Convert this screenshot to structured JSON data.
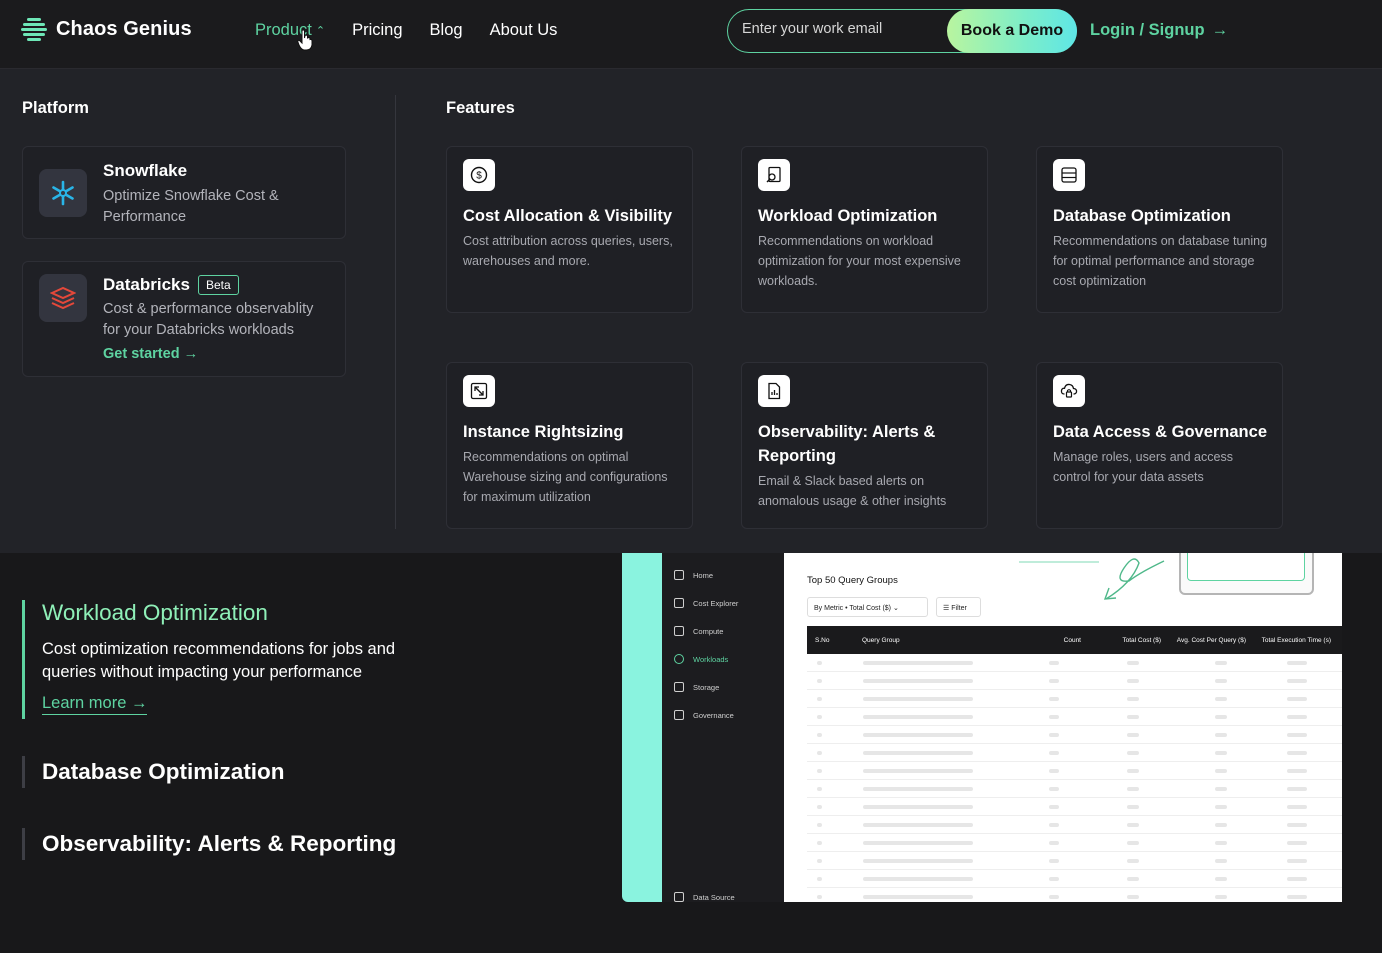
{
  "brand": {
    "name": "Chaos Genius"
  },
  "nav": {
    "items": [
      {
        "label": "Product",
        "active": true
      },
      {
        "label": "Pricing"
      },
      {
        "label": "Blog"
      },
      {
        "label": "About Us"
      }
    ],
    "email_placeholder": "Enter your work email",
    "demo_label": "Book a Demo",
    "login_label": "Login / Signup"
  },
  "platform": {
    "title": "Platform",
    "cards": [
      {
        "title": "Snowflake",
        "desc": "Optimize Snowflake Cost & Performance"
      },
      {
        "title": "Databricks",
        "badge": "Beta",
        "desc": "Cost & performance observablity for your Databricks workloads",
        "cta": "Get started"
      }
    ]
  },
  "features": {
    "title": "Features",
    "cards": [
      {
        "title": "Cost Allocation & Visibility",
        "desc": "Cost attribution across queries, users, warehouses and more."
      },
      {
        "title": "Workload Optimization",
        "desc": "Recommendations on workload optimization for your most expensive workloads."
      },
      {
        "title": "Database Optimization",
        "desc": "Recommendations on database tuning for optimal performance and storage cost optimization"
      },
      {
        "title": "Instance Rightsizing",
        "desc": "Recommendations on optimal Warehouse sizing and configurations for maximum utilization"
      },
      {
        "title": "Observability: Alerts & Reporting",
        "desc": "Email & Slack based alerts on anomalous usage & other insights"
      },
      {
        "title": "Data Access & Governance",
        "desc": "Manage roles, users and access control for your data assets"
      }
    ]
  },
  "showcase": {
    "items": [
      {
        "title": "Workload Optimization",
        "desc": "Cost optimization recommendations for jobs and queries without impacting your performance",
        "link": "Learn more"
      },
      {
        "title": "Database Optimization"
      },
      {
        "title": "Observability: Alerts & Reporting"
      }
    ]
  },
  "preview": {
    "sidebar": [
      "Home",
      "Cost Explorer",
      "Compute",
      "Workloads",
      "Storage",
      "Governance"
    ],
    "sidebar_bottom": "Data Source",
    "title": "Top 50 Query Groups",
    "selector": "By Metric • Total Cost ($)",
    "filter": "Filter",
    "columns": [
      "S.No",
      "Query Group",
      "Count",
      "Total Cost ($)",
      "Avg. Cost Per Query ($)",
      "Total Execution Time (s)"
    ]
  },
  "colors": {
    "accent": "#5ed3a1",
    "bg": "#18181a",
    "panel": "#222328"
  }
}
